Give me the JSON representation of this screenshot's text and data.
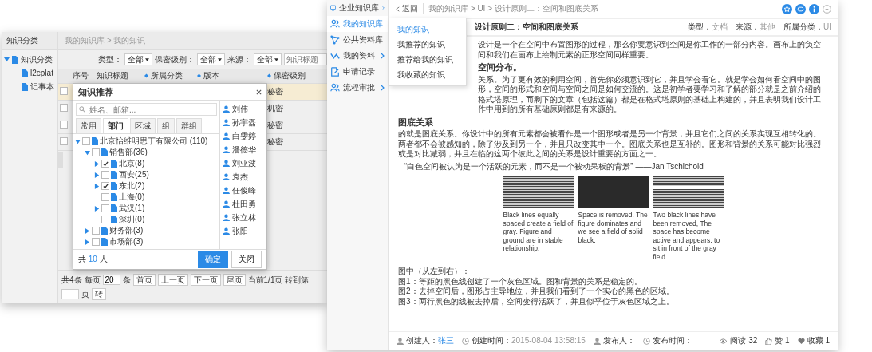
{
  "left_window": {
    "sidebar": {
      "title": "知识分类",
      "tree": [
        {
          "label": "知识分类",
          "expanded": true,
          "children": [
            {
              "label": "l2cplat"
            },
            {
              "label": "记事本"
            }
          ]
        }
      ]
    },
    "breadcrumb": "我的知识库 > 我的知识",
    "filters": [
      {
        "label": "类型：",
        "value": "全部"
      },
      {
        "label": "保密级别：",
        "value": "全部"
      },
      {
        "label": "来源：",
        "value": "全部"
      }
    ],
    "search": {
      "placeholder": "知识标题"
    },
    "table": {
      "columns": [
        "序号",
        "知识标题",
        "所属分类",
        "版本",
        "保密级别"
      ],
      "rows": [
        {
          "selected": true,
          "checked": false,
          "secrecy": "秘密"
        },
        {
          "selected": false,
          "checked": false,
          "secrecy": "机密"
        },
        {
          "selected": false,
          "checked": false,
          "secrecy": "秘密"
        },
        {
          "selected": false,
          "checked": false,
          "secrecy": "秘密"
        }
      ]
    },
    "pagination": {
      "total": "共4条",
      "per_page_label": "每页",
      "per_page": "20",
      "unit": "条",
      "buttons": [
        "首页",
        "上一页",
        "下一页",
        "尾页"
      ],
      "current": "当前1/1页",
      "goto_label": "转到第",
      "goto_unit": "页",
      "go": "转"
    },
    "dialog": {
      "title": "知识推荐",
      "search": {
        "placeholder": "姓名、邮箱..."
      },
      "tabs": [
        {
          "label": "常用",
          "selected": false
        },
        {
          "label": "部门",
          "selected": true
        },
        {
          "label": "区域",
          "selected": false
        },
        {
          "label": "组",
          "selected": false
        },
        {
          "label": "群组",
          "selected": false
        }
      ],
      "tree": [
        {
          "label": "北京怡维明思丁有限公司 (110)",
          "checked": false,
          "expanded": true,
          "children": [
            {
              "label": "销售部(36)",
              "checked": false,
              "expanded": true,
              "children": [
                {
                  "label": "北京(8)",
                  "checked": true,
                  "expanded": false
                },
                {
                  "label": "西安(25)",
                  "checked": false,
                  "expanded": false
                },
                {
                  "label": "东北(2)",
                  "checked": true,
                  "expanded": false
                },
                {
                  "label": "上海(0)",
                  "checked": false
                },
                {
                  "label": "武汉(1)",
                  "checked": false,
                  "expanded": false
                },
                {
                  "label": "深圳(0)",
                  "checked": false
                }
              ]
            },
            {
              "label": "财务部(3)",
              "checked": false,
              "expanded": false
            },
            {
              "label": "市场部(3)",
              "checked": false,
              "expanded": false
            }
          ]
        }
      ],
      "people": [
        "刘伟",
        "孙宇磊",
        "白雯婷",
        "潘德华",
        "刘亚波",
        "袁杰",
        "任俊峰",
        "杜田勇",
        "张立林",
        "张阳"
      ],
      "count_prefix": "共",
      "count": "10",
      "count_suffix": "人",
      "buttons": [
        {
          "label": "确定",
          "kind": "primary"
        },
        {
          "label": "关闭",
          "kind": "default"
        }
      ]
    }
  },
  "right_window": {
    "nav": [
      {
        "label": "企业知识库",
        "selected": false,
        "has_submenu": true
      },
      {
        "label": "我的知识库",
        "selected": true,
        "has_submenu": false
      },
      {
        "label": "公共资料库",
        "selected": false,
        "has_submenu": false
      },
      {
        "label": "我的资料",
        "selected": false,
        "has_submenu": true
      },
      {
        "label": "申请记录",
        "selected": false,
        "has_submenu": false
      },
      {
        "label": "流程审批",
        "selected": false,
        "has_submenu": true
      }
    ],
    "submenu": [
      {
        "label": "我的知识",
        "selected": true
      },
      {
        "label": "我推荐的知识",
        "selected": false
      },
      {
        "label": "推荐给我的知识",
        "selected": false
      },
      {
        "label": "我收藏的知识",
        "selected": false
      }
    ],
    "back": "返回",
    "breadcrumb": "我的知识库 > UI > 设计原则二：空间和图底关系",
    "title": "设计原则二：空间和图底关系",
    "meta": [
      {
        "label": "类型：",
        "value": "文档"
      },
      {
        "label": "来源：",
        "value": "其他"
      },
      {
        "label": "所属分类：",
        "value": "UI"
      }
    ],
    "body": [
      {
        "kind": "paragraph",
        "text": "设计是一个在空间中布置图形的过程，那么你要意识到空间是你工作的一部分内容。画布上的负空间和我们在画布上绘制元素的正形空间同样重要。"
      },
      {
        "kind": "heading",
        "text": "空间分布。"
      },
      {
        "kind": "paragraph",
        "text": "关系。为了更有效的利用空间，首先你必须意识到它，并且学会看它。就是学会如何看空间中的图形，空间的形式和空间与空间之间是如何交流的。这是初学者要学习和了解的部分就是之前介绍的格式塔原理，而剩下的文章（包括这篇）都是在格式塔原则的基础上构建的，并且表明我们设计工作中用到的所有基础原则都是有来源的。"
      },
      {
        "kind": "heading",
        "text": "图底关系"
      },
      {
        "kind": "paragraph",
        "text": "的就是图底关系。你设计中的所有元素都会被看作是一个图形或者是另一个背景，并且它们之间的关系实现互相转化的。两者都不会被感知的，除了涉及到另一个，并且只改变其中一个。图底关系也是互补的。图形和背景的关系可能对比强烈或是对比减弱，并且在临的这两个彼此之间的关系是设计重要的方面之一。"
      },
      {
        "kind": "quote",
        "text": "“白色空间被认为是一个活跃的元素，而不是一个被动呆板的背景” ——Jan Tschichold"
      }
    ],
    "figures": [
      {
        "kind": "lines",
        "caption": "Black lines equally spaced create a field of gray. Figure and ground are in stable relationship."
      },
      {
        "kind": "solid",
        "caption": "Space is removed. The figure dominates and we see a field of solid black."
      },
      {
        "kind": "split",
        "caption": "Two black lines have been removed, The space has become active and appears. to sit in front of the gray field."
      }
    ],
    "notes": [
      "图中（从左到右）：",
      "图1：等距的黑色线创建了一个灰色区域。图和背景的关系是稳定的。",
      "图2：去掉空间后，图形占主导地位，并且我们看到了一个实心的黑色的区域。",
      "图3：两行黑色的线被去掉后，空间变得活跃了，并且似乎位于灰色区域之上。"
    ],
    "footer": {
      "creator_label": "创建人：",
      "creator": "张三",
      "created_label": "创建时间：",
      "created": "2015-08-04 13:58:15",
      "publisher_label": "发布人：",
      "published_label": "发布时间：",
      "stats": [
        {
          "kind": "views",
          "text": "阅读 32"
        },
        {
          "kind": "likes",
          "text": "赞 1"
        },
        {
          "kind": "favorites",
          "text": "收藏 1"
        }
      ]
    }
  }
}
